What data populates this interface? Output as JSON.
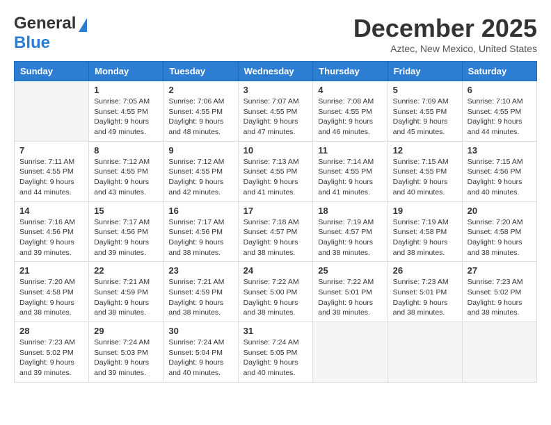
{
  "header": {
    "logo_general": "General",
    "logo_blue": "Blue",
    "month_title": "December 2025",
    "location": "Aztec, New Mexico, United States"
  },
  "weekdays": [
    "Sunday",
    "Monday",
    "Tuesday",
    "Wednesday",
    "Thursday",
    "Friday",
    "Saturday"
  ],
  "weeks": [
    [
      {
        "day": "",
        "empty": true
      },
      {
        "day": "1",
        "sunrise": "Sunrise: 7:05 AM",
        "sunset": "Sunset: 4:55 PM",
        "daylight": "Daylight: 9 hours and 49 minutes."
      },
      {
        "day": "2",
        "sunrise": "Sunrise: 7:06 AM",
        "sunset": "Sunset: 4:55 PM",
        "daylight": "Daylight: 9 hours and 48 minutes."
      },
      {
        "day": "3",
        "sunrise": "Sunrise: 7:07 AM",
        "sunset": "Sunset: 4:55 PM",
        "daylight": "Daylight: 9 hours and 47 minutes."
      },
      {
        "day": "4",
        "sunrise": "Sunrise: 7:08 AM",
        "sunset": "Sunset: 4:55 PM",
        "daylight": "Daylight: 9 hours and 46 minutes."
      },
      {
        "day": "5",
        "sunrise": "Sunrise: 7:09 AM",
        "sunset": "Sunset: 4:55 PM",
        "daylight": "Daylight: 9 hours and 45 minutes."
      },
      {
        "day": "6",
        "sunrise": "Sunrise: 7:10 AM",
        "sunset": "Sunset: 4:55 PM",
        "daylight": "Daylight: 9 hours and 44 minutes."
      }
    ],
    [
      {
        "day": "7",
        "sunrise": "Sunrise: 7:11 AM",
        "sunset": "Sunset: 4:55 PM",
        "daylight": "Daylight: 9 hours and 44 minutes."
      },
      {
        "day": "8",
        "sunrise": "Sunrise: 7:12 AM",
        "sunset": "Sunset: 4:55 PM",
        "daylight": "Daylight: 9 hours and 43 minutes."
      },
      {
        "day": "9",
        "sunrise": "Sunrise: 7:12 AM",
        "sunset": "Sunset: 4:55 PM",
        "daylight": "Daylight: 9 hours and 42 minutes."
      },
      {
        "day": "10",
        "sunrise": "Sunrise: 7:13 AM",
        "sunset": "Sunset: 4:55 PM",
        "daylight": "Daylight: 9 hours and 41 minutes."
      },
      {
        "day": "11",
        "sunrise": "Sunrise: 7:14 AM",
        "sunset": "Sunset: 4:55 PM",
        "daylight": "Daylight: 9 hours and 41 minutes."
      },
      {
        "day": "12",
        "sunrise": "Sunrise: 7:15 AM",
        "sunset": "Sunset: 4:55 PM",
        "daylight": "Daylight: 9 hours and 40 minutes."
      },
      {
        "day": "13",
        "sunrise": "Sunrise: 7:15 AM",
        "sunset": "Sunset: 4:56 PM",
        "daylight": "Daylight: 9 hours and 40 minutes."
      }
    ],
    [
      {
        "day": "14",
        "sunrise": "Sunrise: 7:16 AM",
        "sunset": "Sunset: 4:56 PM",
        "daylight": "Daylight: 9 hours and 39 minutes."
      },
      {
        "day": "15",
        "sunrise": "Sunrise: 7:17 AM",
        "sunset": "Sunset: 4:56 PM",
        "daylight": "Daylight: 9 hours and 39 minutes."
      },
      {
        "day": "16",
        "sunrise": "Sunrise: 7:17 AM",
        "sunset": "Sunset: 4:56 PM",
        "daylight": "Daylight: 9 hours and 38 minutes."
      },
      {
        "day": "17",
        "sunrise": "Sunrise: 7:18 AM",
        "sunset": "Sunset: 4:57 PM",
        "daylight": "Daylight: 9 hours and 38 minutes."
      },
      {
        "day": "18",
        "sunrise": "Sunrise: 7:19 AM",
        "sunset": "Sunset: 4:57 PM",
        "daylight": "Daylight: 9 hours and 38 minutes."
      },
      {
        "day": "19",
        "sunrise": "Sunrise: 7:19 AM",
        "sunset": "Sunset: 4:58 PM",
        "daylight": "Daylight: 9 hours and 38 minutes."
      },
      {
        "day": "20",
        "sunrise": "Sunrise: 7:20 AM",
        "sunset": "Sunset: 4:58 PM",
        "daylight": "Daylight: 9 hours and 38 minutes."
      }
    ],
    [
      {
        "day": "21",
        "sunrise": "Sunrise: 7:20 AM",
        "sunset": "Sunset: 4:58 PM",
        "daylight": "Daylight: 9 hours and 38 minutes."
      },
      {
        "day": "22",
        "sunrise": "Sunrise: 7:21 AM",
        "sunset": "Sunset: 4:59 PM",
        "daylight": "Daylight: 9 hours and 38 minutes."
      },
      {
        "day": "23",
        "sunrise": "Sunrise: 7:21 AM",
        "sunset": "Sunset: 4:59 PM",
        "daylight": "Daylight: 9 hours and 38 minutes."
      },
      {
        "day": "24",
        "sunrise": "Sunrise: 7:22 AM",
        "sunset": "Sunset: 5:00 PM",
        "daylight": "Daylight: 9 hours and 38 minutes."
      },
      {
        "day": "25",
        "sunrise": "Sunrise: 7:22 AM",
        "sunset": "Sunset: 5:01 PM",
        "daylight": "Daylight: 9 hours and 38 minutes."
      },
      {
        "day": "26",
        "sunrise": "Sunrise: 7:23 AM",
        "sunset": "Sunset: 5:01 PM",
        "daylight": "Daylight: 9 hours and 38 minutes."
      },
      {
        "day": "27",
        "sunrise": "Sunrise: 7:23 AM",
        "sunset": "Sunset: 5:02 PM",
        "daylight": "Daylight: 9 hours and 38 minutes."
      }
    ],
    [
      {
        "day": "28",
        "sunrise": "Sunrise: 7:23 AM",
        "sunset": "Sunset: 5:02 PM",
        "daylight": "Daylight: 9 hours and 39 minutes."
      },
      {
        "day": "29",
        "sunrise": "Sunrise: 7:24 AM",
        "sunset": "Sunset: 5:03 PM",
        "daylight": "Daylight: 9 hours and 39 minutes."
      },
      {
        "day": "30",
        "sunrise": "Sunrise: 7:24 AM",
        "sunset": "Sunset: 5:04 PM",
        "daylight": "Daylight: 9 hours and 40 minutes."
      },
      {
        "day": "31",
        "sunrise": "Sunrise: 7:24 AM",
        "sunset": "Sunset: 5:05 PM",
        "daylight": "Daylight: 9 hours and 40 minutes."
      },
      {
        "day": "",
        "empty": true
      },
      {
        "day": "",
        "empty": true
      },
      {
        "day": "",
        "empty": true
      }
    ]
  ]
}
